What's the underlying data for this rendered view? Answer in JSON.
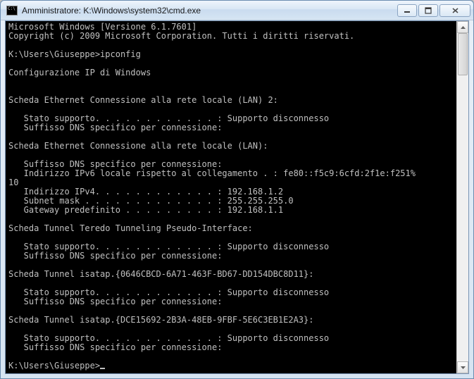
{
  "window": {
    "title": "Amministratore: K:\\Windows\\system32\\cmd.exe"
  },
  "terminal": {
    "lines": [
      "Microsoft Windows [Versione 6.1.7601]",
      "Copyright (c) 2009 Microsoft Corporation. Tutti i diritti riservati.",
      "",
      "K:\\Users\\Giuseppe>ipconfig",
      "",
      "Configurazione IP di Windows",
      "",
      "",
      "Scheda Ethernet Connessione alla rete locale (LAN) 2:",
      "",
      "   Stato supporto. . . . . . . . . . . . : Supporto disconnesso",
      "   Suffisso DNS specifico per connessione:",
      "",
      "Scheda Ethernet Connessione alla rete locale (LAN):",
      "",
      "   Suffisso DNS specifico per connessione:",
      "   Indirizzo IPv6 locale rispetto al collegamento . : fe80::f5c9:6cfd:2f1e:f251%",
      "10",
      "   Indirizzo IPv4. . . . . . . . . . . . : 192.168.1.2",
      "   Subnet mask . . . . . . . . . . . . . : 255.255.255.0",
      "   Gateway predefinito . . . . . . . . . : 192.168.1.1",
      "",
      "Scheda Tunnel Teredo Tunneling Pseudo-Interface:",
      "",
      "   Stato supporto. . . . . . . . . . . . : Supporto disconnesso",
      "   Suffisso DNS specifico per connessione:",
      "",
      "Scheda Tunnel isatap.{0646CBCD-6A71-463F-BD67-DD154DBC8D11}:",
      "",
      "   Stato supporto. . . . . . . . . . . . : Supporto disconnesso",
      "   Suffisso DNS specifico per connessione:",
      "",
      "Scheda Tunnel isatap.{DCE15692-2B3A-48EB-9FBF-5E6C3EB1E2A3}:",
      "",
      "   Stato supporto. . . . . . . . . . . . : Supporto disconnesso",
      "   Suffisso DNS specifico per connessione:",
      "",
      "K:\\Users\\Giuseppe>"
    ]
  }
}
